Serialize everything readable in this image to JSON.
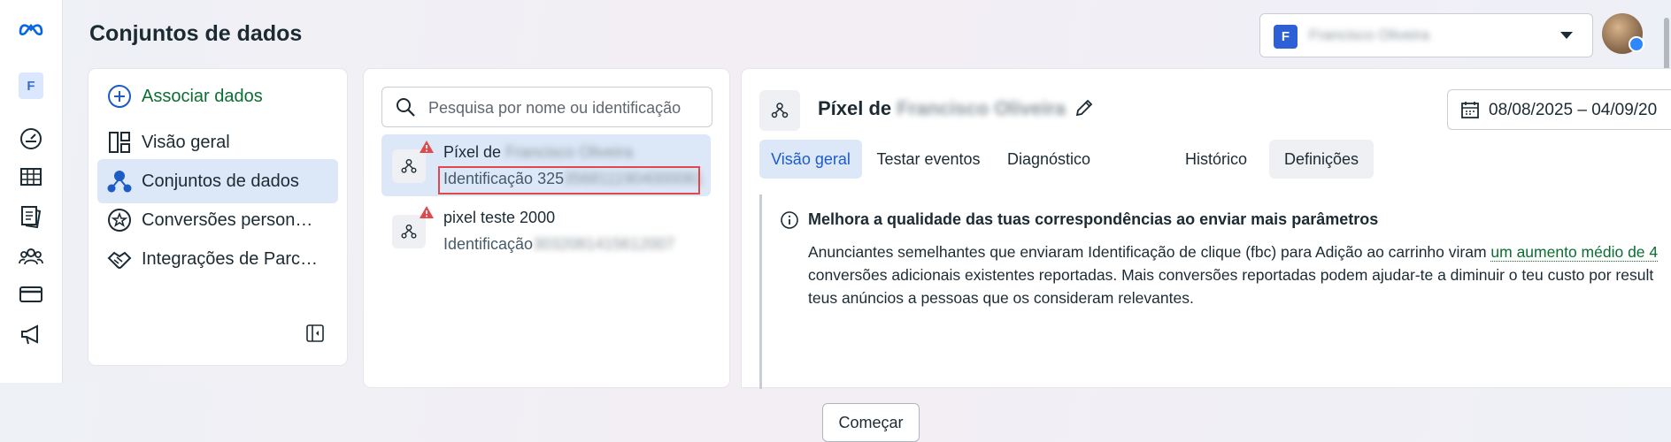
{
  "page": {
    "title": "Conjuntos de dados"
  },
  "rail": {
    "logo_icon": "meta-logo",
    "account_initial": "F",
    "icons": [
      "dashboard-gauge-icon",
      "table-icon",
      "pages-icon",
      "people-icon",
      "card-icon",
      "megaphone-icon"
    ]
  },
  "header": {
    "account_initial": "F",
    "account_name": "Francisco Oliveira",
    "user_avatar": "user-avatar"
  },
  "sidebar": {
    "items": [
      {
        "label": "Associar dados",
        "icon": "plus-circle-icon"
      },
      {
        "label": "Visão geral",
        "icon": "layout-icon"
      },
      {
        "label": "Conjuntos de dados",
        "icon": "datasets-icon"
      },
      {
        "label": "Conversões person…",
        "icon": "star-badge-icon"
      },
      {
        "label": "Integrações de Parc…",
        "icon": "handshake-icon"
      }
    ],
    "collapse_icon": "collapse-panel-icon"
  },
  "list": {
    "search_placeholder": "Pesquisa por nome ou identificação",
    "items": [
      {
        "name_prefix": "Píxel de",
        "name_blurred": "Francisco Oliveira",
        "id_prefix": "Identificação 325",
        "id_blurred": "3568111904000081"
      },
      {
        "name_prefix": "pixel teste 2000",
        "name_blurred": "",
        "id_prefix": "Identificação",
        "id_blurred": "3032081415612007"
      }
    ]
  },
  "detail": {
    "title_prefix": "Píxel de",
    "title_blurred": "Francisco Oliveira",
    "date_range": "08/08/2025 – 04/09/20",
    "tabs": [
      "Visão geral",
      "Testar eventos",
      "Diagnóstico",
      "Histórico",
      "Definições"
    ],
    "notice": {
      "heading": "Melhora a qualidade das tuas correspondências ao enviar mais parâmetros",
      "line1": "Anunciantes semelhantes que enviaram Identificação de clique (fbc) para Adição ao carrinho viram ",
      "line1_link": "um aumento médio de 4",
      "line2": "conversões adicionais existentes reportadas. Mais conversões reportadas podem ajudar-te a diminuir o teu custo por result",
      "line3": "teus anúncios a pessoas que os consideram relevantes.",
      "button": "Começar"
    }
  },
  "colors": {
    "accent": "#1d5bc6",
    "active_bg": "#dce8f7",
    "link_green": "#0a6e31",
    "warning_red": "#e0494a"
  }
}
